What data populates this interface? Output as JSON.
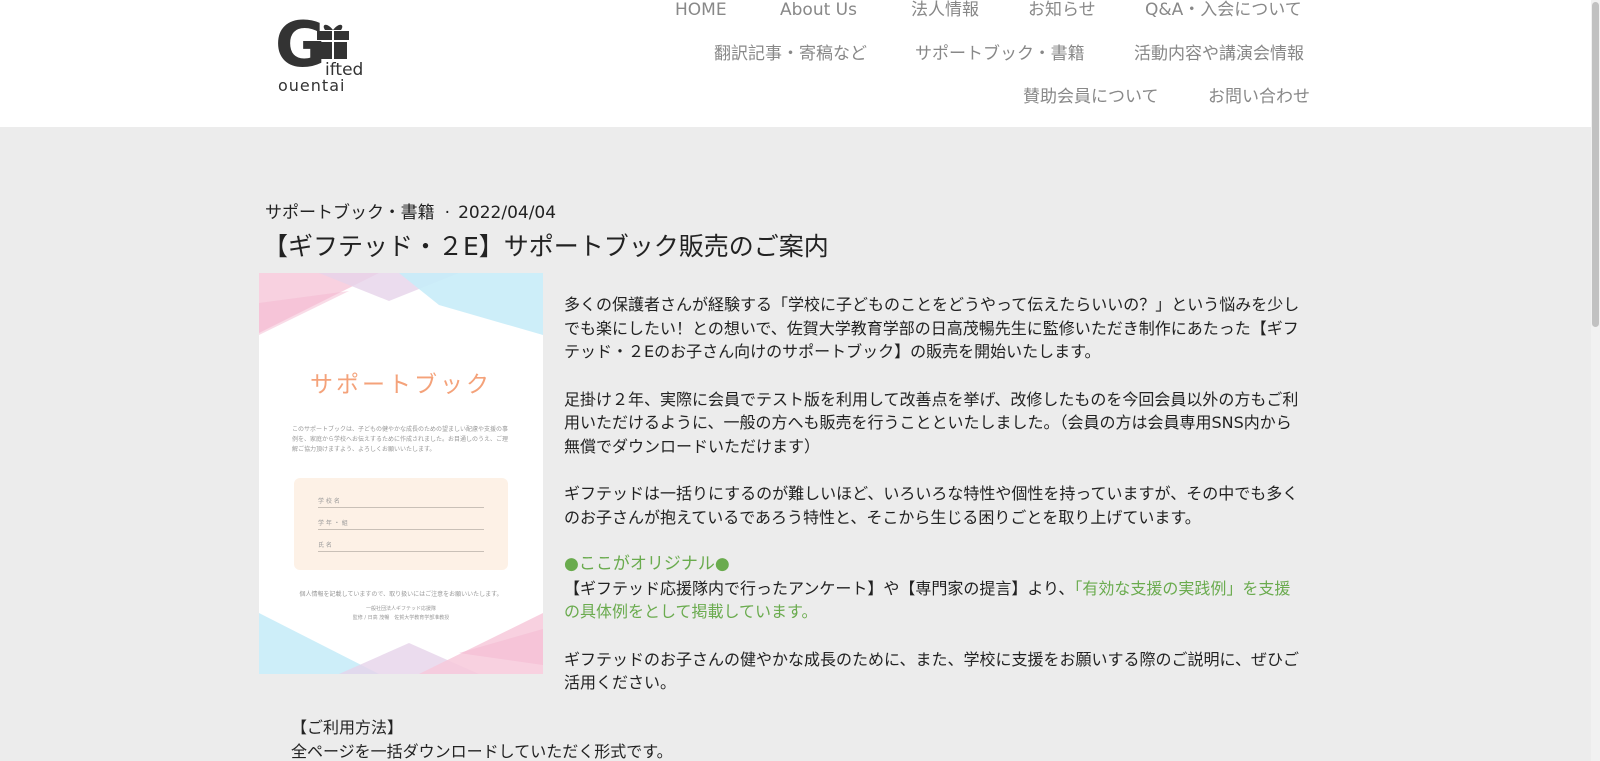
{
  "logo": {
    "letter": "G",
    "line1": "ifted",
    "line2": "ouentai"
  },
  "nav": {
    "row1": [
      "HOME",
      "About Us",
      "法人情報",
      "お知らせ",
      "Q&A・入会について"
    ],
    "row2": [
      "翻訳記事・寄稿など",
      "サポートブック・書籍",
      "活動内容や講演会情報"
    ],
    "row3": [
      "賛助会員について",
      "お問い合わせ"
    ]
  },
  "article": {
    "category": "サポートブック・書籍",
    "separator": "·",
    "date": "2022/04/04",
    "title": "【ギフテッド・２E】サポートブック販売のご案内",
    "cover": {
      "title": "サポートブック",
      "desc": "このサポートブックは、子どもの健やかな成長のための望ましい配慮や支援の事例を、家庭から学校へお伝えするために作成されました。お目通しのうえ、ご理解ご協力頂けますよう、よろしくお願いいたします。",
      "fields": [
        "学 校 名",
        "学 年 ・ 組",
        "氏 名"
      ],
      "note": "個人情報を記載していますので、取り扱いにはご注意をお願いいたします。",
      "org_line1": "一般社団法人ギフテッド応援隊",
      "org_line2": "監修 / 日高 茂暢　佐賀大学教育学部准教授"
    },
    "p1": "多くの保護者さんが経験する「学校に子どものことをどうやって伝えたらいいの？」という悩みを少しでも楽にしたい！との想いで、佐賀大学教育学部の日高茂暢先生に監修いただき制作にあたった【ギフテッド・２Eのお子さん向けのサポートブック】の販売を開始いたします。",
    "p2": "足掛け２年、実際に会員でテスト版を利用して改善点を挙げ、改修したものを今回会員以外の方もご利用いただけるように、一般の方へも販売を行うことといたしました。（会員の方は会員専用SNS内から無償でダウンロードいただけます）",
    "p3": "ギフテッドは一括りにするのが難しいほど、いろいろな特性や個性を持っていますが、その中でも多くのお子さんが抱えているであろう特性と、そこから生じる困りごとを取り上げています。",
    "original_head": "●ここがオリジナル●",
    "p4_plain": "【ギフテッド応援隊内で行ったアンケート】や【専門家の提言】より、",
    "p4_green": "「有効な支援の実践例」を支援の具体例をとして掲載しています。",
    "p5": "ギフテッドのお子さんの健やかな成長のために、また、学校に支援をお願いする際のご説明に、ぜひご活用ください。",
    "usage_head": "【ご利用方法】",
    "usage_line": "全ページを一括ダウンロードしていただく形式です。"
  },
  "colors": {
    "accent_green": "#6aab4e",
    "nav_gray": "#888888",
    "cover_title": "#f4a27a",
    "page_bg": "#ececec"
  }
}
